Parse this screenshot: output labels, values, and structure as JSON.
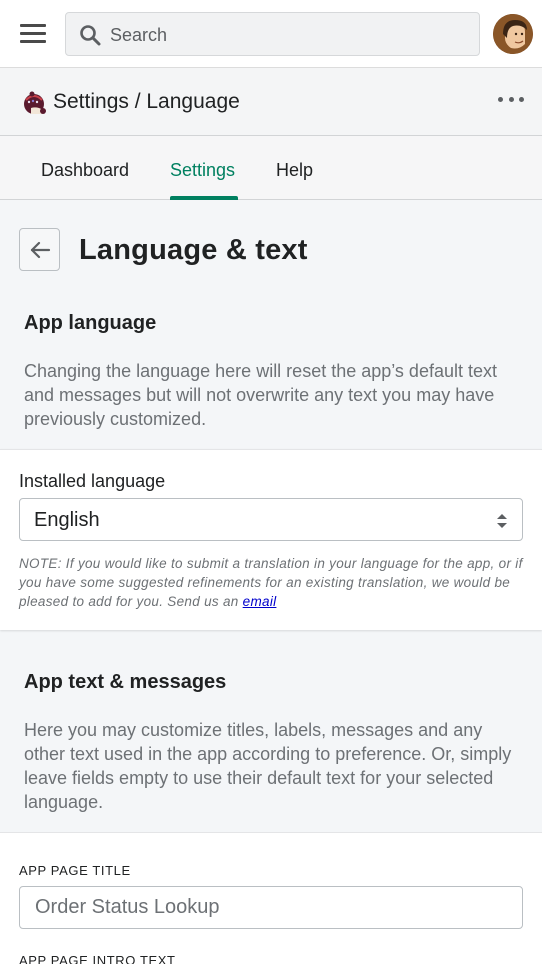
{
  "topbar": {
    "search_placeholder": "Search",
    "menu_icon": "hamburger-menu-icon",
    "search_icon": "search-icon",
    "avatar_icon": "user-avatar"
  },
  "pagebar": {
    "breadcrumb": "Settings / Language",
    "app_icon": "app-logo-icon",
    "more_icon": "more-horizontal-icon"
  },
  "tabs": [
    {
      "label": "Dashboard",
      "active": false
    },
    {
      "label": "Settings",
      "active": true
    },
    {
      "label": "Help",
      "active": false
    }
  ],
  "page": {
    "title": "Language & text",
    "back_icon": "arrow-left-icon"
  },
  "app_language": {
    "heading": "App language",
    "description": "Changing the language here will reset the app’s default text and messages but will not overwrite any text you may have previously customized.",
    "field_label": "Installed language",
    "selected_value": "English",
    "note_text": "NOTE: If you would like to submit a translation in your language for the app, or if you have some suggested refinements for an existing translation, we would be pleased to add for you. Send us an ",
    "note_link": "email"
  },
  "app_text": {
    "heading": "App text & messages",
    "description": "Here you may customize titles, labels, messages and any other text used in the app according to preference. Or, simply leave fields empty to use their default text for your selected language.",
    "fields": [
      {
        "label": "APP PAGE TITLE",
        "placeholder": "Order Status Lookup",
        "value": ""
      },
      {
        "label": "APP PAGE INTRO TEXT"
      }
    ]
  },
  "colors": {
    "accent": "#008060",
    "link": "#0000cc",
    "background": "#f4f6f8"
  }
}
